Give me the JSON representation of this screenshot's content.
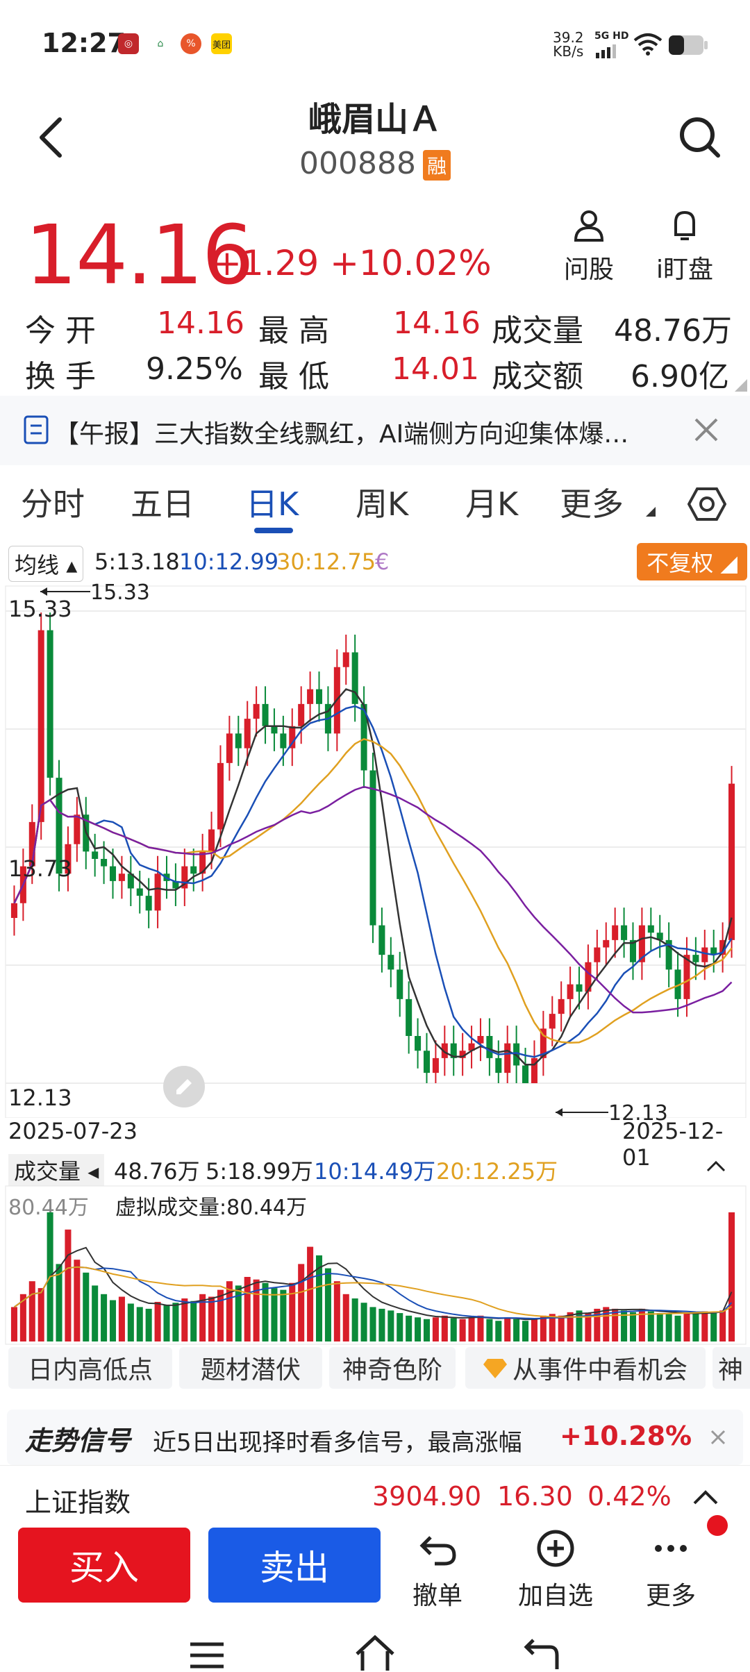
{
  "status_bar": {
    "time": "12:27",
    "net_speed": "39.2",
    "net_unit": "KB/s",
    "net_type": "5G HD",
    "app_label_meituan": "美团"
  },
  "header": {
    "title": "峨眉山Ａ",
    "code": "000888",
    "rong_badge": "融",
    "ask_label": "问股",
    "watch_label": "i盯盘"
  },
  "quote": {
    "price": "14.16",
    "change": "+1.29",
    "change_pct": "+10.02%",
    "today_open_label": "今 开",
    "today_open": "14.16",
    "high_label": "最 高",
    "high": "14.16",
    "volume_label": "成交量",
    "volume": "48.76万",
    "turnover_label": "换 手",
    "turnover": "9.25%",
    "low_label": "最 低",
    "low": "14.01",
    "amount_label": "成交额",
    "amount": "6.90亿"
  },
  "banner": {
    "text": "【午报】三大指数全线飘红，AI端侧方向迎集体爆…"
  },
  "tabs": [
    {
      "label": "分时"
    },
    {
      "label": "五日"
    },
    {
      "label": "日K"
    },
    {
      "label": "周K"
    },
    {
      "label": "月K"
    },
    {
      "label": "更多"
    }
  ],
  "ma_legend": {
    "selector": "均线",
    "ma5": "5:13.18",
    "ma10": "10:12.99",
    "ma30": "30:12.75",
    "restore": "不复权"
  },
  "chart_data": {
    "type": "candlestick",
    "y_top_label": "15.33",
    "y_mid_label": "13.73",
    "y_bottom_label": "12.13",
    "max_marker": "15.33",
    "min_marker": "12.13",
    "date_start": "2025-07-23",
    "date_end": "2025-12-01",
    "ylim": [
      12.13,
      15.33
    ],
    "colors": {
      "up": "#d81e2a",
      "down": "#0a8a3a",
      "ma5": "#333333",
      "ma10": "#1a4fb6",
      "ma20": "#e0a020",
      "ma30": "#7a1fa0"
    },
    "closes": [
      13.35,
      13.6,
      13.9,
      15.2,
      14.2,
      13.55,
      13.75,
      13.95,
      13.7,
      13.65,
      13.6,
      13.5,
      13.55,
      13.45,
      13.4,
      13.3,
      13.55,
      13.5,
      13.45,
      13.6,
      13.55,
      13.7,
      13.85,
      14.3,
      14.5,
      14.4,
      14.6,
      14.7,
      14.55,
      14.5,
      14.4,
      14.55,
      14.7,
      14.8,
      14.7,
      14.5,
      14.95,
      15.05,
      14.7,
      14.25,
      13.2,
      13.0,
      12.9,
      12.7,
      12.45,
      12.35,
      12.2,
      12.3,
      12.4,
      12.3,
      12.35,
      12.4,
      12.45,
      12.3,
      12.2,
      12.4,
      12.25,
      12.13,
      12.3,
      12.5,
      12.6,
      12.7,
      12.8,
      12.75,
      12.95,
      13.05,
      13.1,
      13.2,
      13.1,
      12.95,
      13.2,
      13.15,
      13.1,
      12.9,
      12.7,
      13.0,
      12.95,
      13.05,
      13.0,
      13.1,
      14.16
    ]
  },
  "volume_panel": {
    "selector": "成交量",
    "current": "48.76万",
    "ma5": "5:18.99万",
    "ma10": "10:14.49万",
    "ma20": "20:12.25万",
    "max_label": "80.44万",
    "virtual_label": "虚拟成交量:80.44万",
    "volumes": [
      40,
      55,
      70,
      62,
      150,
      90,
      130,
      95,
      80,
      65,
      55,
      48,
      52,
      44,
      40,
      38,
      46,
      42,
      45,
      50,
      47,
      55,
      52,
      60,
      70,
      65,
      75,
      72,
      68,
      62,
      60,
      68,
      90,
      110,
      100,
      85,
      70,
      55,
      50,
      45,
      40,
      38,
      36,
      33,
      30,
      28,
      26,
      28,
      30,
      27,
      26,
      28,
      30,
      26,
      24,
      28,
      26,
      24,
      27,
      30,
      32,
      30,
      34,
      36,
      33,
      38,
      40,
      38,
      36,
      34,
      38,
      35,
      33,
      32,
      30,
      34,
      33,
      35,
      34,
      36,
      150
    ]
  },
  "feature_tabs": [
    {
      "label": "日内高低点"
    },
    {
      "label": "题材潜伏"
    },
    {
      "label": "神奇色阶"
    },
    {
      "label": "从事件中看机会"
    },
    {
      "label": "神"
    }
  ],
  "signal": {
    "brand": "走势信号",
    "text": "近5日出现择时看多信号，最高涨幅",
    "value": "+10.28%"
  },
  "index": {
    "name": "上证指数",
    "value": "3904.90",
    "change": "16.30",
    "pct": "0.42%"
  },
  "actions": {
    "buy": "买入",
    "sell": "卖出",
    "cancel": "撤单",
    "add_watch": "加自选",
    "more": "更多"
  }
}
